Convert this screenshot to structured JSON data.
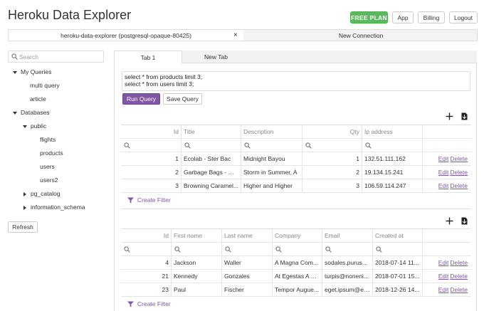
{
  "header": {
    "title": "Heroku Data Explorer",
    "free_plan": "FREE PLAN",
    "app": "App",
    "billing": "Billing",
    "logout": "Logout"
  },
  "connections": {
    "active": "heroku-data-explorer (postgresql-opaque-80425)",
    "close": "×",
    "new": "New Connection"
  },
  "sidebar": {
    "search_placeholder": "Search",
    "my_queries": "My Queries",
    "queries": [
      "multi query",
      "article"
    ],
    "databases": "Databases",
    "public": "public",
    "tables": [
      "flights",
      "products",
      "users",
      "users2"
    ],
    "pg_catalog": "pg_catalog",
    "information_schema": "information_schema",
    "refresh": "Refresh"
  },
  "tabs": [
    "Tab 1",
    "New Tab"
  ],
  "editor": {
    "lines": [
      "select * from products limit 3;",
      "select * from users limit 3;"
    ],
    "run": "Run Query",
    "save": "Save Query"
  },
  "products": {
    "headers": [
      "Id",
      "Title",
      "Description",
      "Qty",
      "Ip address"
    ],
    "rows": [
      [
        "1",
        "Ecolab - Ster Bac",
        "Midnight Bayou",
        "1",
        "132.51.111.162"
      ],
      [
        "2",
        "Garbage Bags - Cl...",
        "Storm in Summer, A",
        "2",
        "19.134.15.241"
      ],
      [
        "3",
        "Browning Caramel...",
        "Higher and Higher",
        "3",
        "106.59.114.247"
      ]
    ]
  },
  "users": {
    "headers": [
      "Id",
      "First name",
      "Last name",
      "Company",
      "Email",
      "Created at"
    ],
    "rows": [
      [
        "4",
        "Jackson",
        "Waller",
        "A Magna Com...",
        "sodales.purus...",
        "2018-07-14 11..."
      ],
      [
        "21",
        "Kennedy",
        "Gonzales",
        "At Egestas A C...",
        "turpis@noneni...",
        "2018-07-01 15..."
      ],
      [
        "23",
        "Paul",
        "Fischer",
        "Tempor Augue...",
        "eget.ipsum@eli...",
        "2018-12-26 14..."
      ]
    ]
  },
  "actions": {
    "edit": "Edit",
    "delete": "Delete"
  },
  "create_filter": "Create Filter",
  "colors": {
    "accent": "#7e57a5",
    "free_plan": "#5cb85c"
  }
}
